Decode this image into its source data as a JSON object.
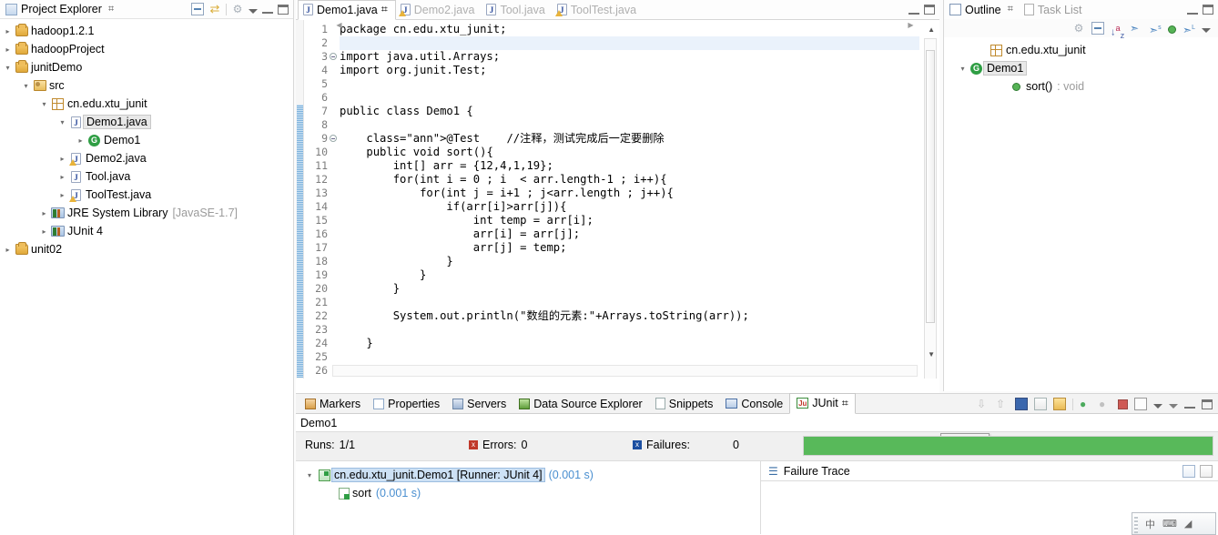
{
  "explorer": {
    "tab_label": "Project Explorer",
    "close_glyph": "⌗",
    "toolbar": [
      "collapse-all-icon",
      "link-with-editor-icon",
      "focus-icon",
      "view-menu-icon",
      "minimize-icon",
      "maximize-icon"
    ],
    "items": [
      {
        "label": "hadoop1.2.1",
        "indent": 0,
        "arrow": "▸",
        "icon": "project-icon",
        "selected": false,
        "suffix": ""
      },
      {
        "label": "hadoopProject",
        "indent": 0,
        "arrow": "▸",
        "icon": "project-icon",
        "selected": false,
        "suffix": ""
      },
      {
        "label": "junitDemo",
        "indent": 0,
        "arrow": "▾",
        "icon": "project-icon",
        "selected": false,
        "suffix": ""
      },
      {
        "label": "src",
        "indent": 1,
        "arrow": "▾",
        "icon": "source-folder-icon",
        "selected": false,
        "suffix": ""
      },
      {
        "label": "cn.edu.xtu_junit",
        "indent": 2,
        "arrow": "▾",
        "icon": "package-icon",
        "selected": false,
        "suffix": ""
      },
      {
        "label": "Demo1.java",
        "indent": 3,
        "arrow": "▾",
        "icon": "java-file-icon",
        "selected": true,
        "suffix": ""
      },
      {
        "label": "Demo1",
        "indent": 4,
        "arrow": "▸",
        "icon": "java-class-icon",
        "selected": false,
        "suffix": ""
      },
      {
        "label": "Demo2.java",
        "indent": 3,
        "arrow": "▸",
        "icon": "java-file-warn-icon",
        "selected": false,
        "suffix": ""
      },
      {
        "label": "Tool.java",
        "indent": 3,
        "arrow": "▸",
        "icon": "java-file-icon",
        "selected": false,
        "suffix": ""
      },
      {
        "label": "ToolTest.java",
        "indent": 3,
        "arrow": "▸",
        "icon": "java-file-warn-icon",
        "selected": false,
        "suffix": ""
      },
      {
        "label": "JRE System Library",
        "indent": 2,
        "arrow": "▸",
        "icon": "library-icon",
        "selected": false,
        "suffix": "[JavaSE-1.7]"
      },
      {
        "label": "JUnit 4",
        "indent": 2,
        "arrow": "▸",
        "icon": "library-icon",
        "selected": false,
        "suffix": ""
      },
      {
        "label": "unit02",
        "indent": 0,
        "arrow": "▸",
        "icon": "project-icon",
        "selected": false,
        "suffix": ""
      }
    ]
  },
  "editor": {
    "tabs": [
      {
        "label": "Demo1.java",
        "active": true,
        "icon": "java-file-icon",
        "close": "⌗"
      },
      {
        "label": "Demo2.java",
        "active": false,
        "icon": "java-file-warn-icon",
        "close": ""
      },
      {
        "label": "Tool.java",
        "active": false,
        "icon": "java-file-icon",
        "close": ""
      },
      {
        "label": "ToolTest.java",
        "active": false,
        "icon": "java-file-warn-icon",
        "close": ""
      }
    ],
    "file_name": "Demo1.java",
    "first_line": 1,
    "last_line": 26,
    "highlighted_line": 2,
    "lines": [
      "package cn.edu.xtu_junit;",
      "",
      "import java.util.Arrays;",
      "import org.junit.Test;",
      "",
      "",
      "public class Demo1 {",
      "",
      "    @Test    //注释，测试完成后一定要删除",
      "    public void sort(){",
      "        int[] arr = {12,4,1,19};",
      "        for(int i = 0 ; i  < arr.length-1 ; i++){",
      "            for(int j = i+1 ; j<arr.length ; j++){",
      "                if(arr[i]>arr[j]){",
      "                    int temp = arr[i];",
      "                    arr[i] = arr[j];",
      "                    arr[j] = temp;",
      "                }",
      "            }",
      "        }",
      "",
      "        System.out.println(\"数组的元素:\"+Arrays.toString(arr));",
      "",
      "    }",
      "",
      ""
    ],
    "fold_lines": [
      3,
      9
    ],
    "window_buttons": [
      "minimize-icon",
      "maximize-icon"
    ]
  },
  "outline": {
    "tabs": [
      {
        "label": "Outline",
        "active": true,
        "icon": "outline-icon",
        "close": "⌗"
      },
      {
        "label": "Task List",
        "active": false,
        "icon": "tasklist-icon",
        "close": ""
      }
    ],
    "toolbar": [
      "focus-icon",
      "collapse-all-icon",
      "sort-icon",
      "hide-fields-icon",
      "hide-static-icon",
      "hide-nonpublic-icon",
      "hide-local-icon",
      "view-menu-icon"
    ],
    "items": [
      {
        "label": "cn.edu.xtu_junit",
        "indent": 1,
        "arrow": "",
        "icon": "package-icon",
        "selected": false,
        "suffix": ""
      },
      {
        "label": "Demo1",
        "indent": 0,
        "arrow": "▾",
        "icon": "java-class-icon",
        "selected": true,
        "suffix": ""
      },
      {
        "label": "sort()",
        "indent": 2,
        "arrow": "",
        "icon": "method-icon",
        "selected": false,
        "suffix": ": void"
      }
    ],
    "window_buttons": [
      "minimize-icon",
      "maximize-icon"
    ]
  },
  "bottom": {
    "tabs": [
      {
        "label": "Markers",
        "active": false,
        "icon": "markers-icon"
      },
      {
        "label": "Properties",
        "active": false,
        "icon": "properties-icon"
      },
      {
        "label": "Servers",
        "active": false,
        "icon": "servers-icon"
      },
      {
        "label": "Data Source Explorer",
        "active": false,
        "icon": "datasource-icon"
      },
      {
        "label": "Snippets",
        "active": false,
        "icon": "snippets-icon"
      },
      {
        "label": "Console",
        "active": false,
        "icon": "console-icon"
      },
      {
        "label": "JUnit",
        "active": true,
        "icon": "junit-icon",
        "close": "⌗"
      }
    ],
    "toolbar": [
      "next-failure-icon",
      "previous-failure-icon",
      "show-failures-only-icon",
      "show-history-icon",
      "lock-scroll-icon",
      "rerun-test-icon",
      "rerun-failed-icon",
      "stop-icon",
      "test-history-icon",
      "history-dropdown-icon",
      "view-menu-icon",
      "minimize-icon",
      "maximize-icon"
    ],
    "junit": {
      "title": "Demo1",
      "runs_label": "Runs:",
      "runs_value": "1/1",
      "errors_label": "Errors:",
      "errors_value": "0",
      "failures_label": "Failures:",
      "failures_value": "0",
      "tooltip": "Demo1",
      "progress_percent": 100,
      "progress_color": "#58b95a",
      "tree": [
        {
          "label": "cn.edu.xtu_junit.Demo1 [Runner: JUnit 4]",
          "time": "(0.001 s)",
          "indent": 0,
          "arrow": "▾",
          "icon": "test-class-icon",
          "selected": true
        },
        {
          "label": "sort",
          "time": "(0.001 s)",
          "indent": 1,
          "arrow": "",
          "icon": "test-method-icon",
          "selected": false
        }
      ],
      "failure_trace_label": "Failure Trace",
      "failure_trace_icons": [
        "compare-result-icon",
        "copy-trace-icon"
      ]
    }
  },
  "ime": {
    "items": [
      "chinese-mode-icon",
      "keyboard-icon",
      "toolbox-icon"
    ],
    "glyphs": [
      "中",
      "⌨",
      "◢"
    ]
  }
}
